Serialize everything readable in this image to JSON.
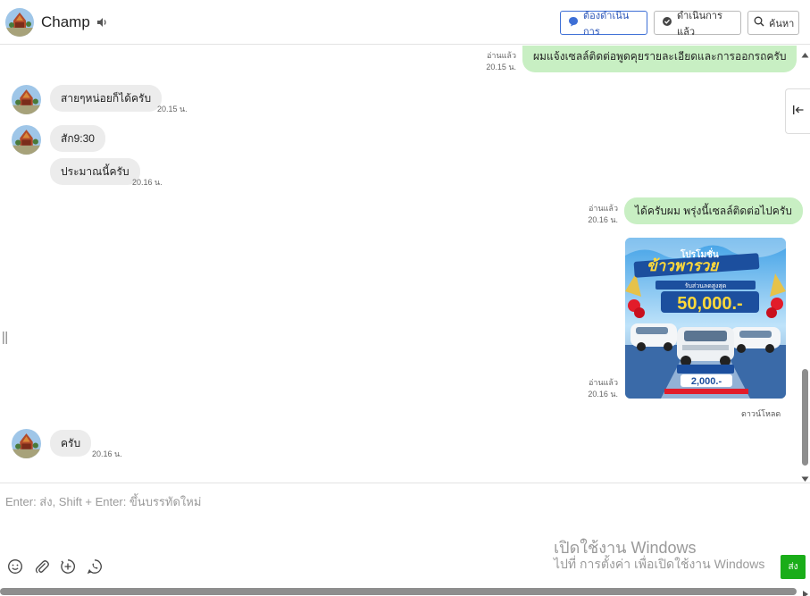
{
  "header": {
    "contact_name": "Champ",
    "btn_todo": "ต้องดำเนินการ",
    "btn_done": "ดำเนินการแล้ว",
    "btn_search": "ค้นหา"
  },
  "messages": {
    "m0": {
      "text": "ผมแจ้งเซลล์ติดต่อพูดคุยรายละเอียดและการออกรถครับ",
      "read": "อ่านแล้ว",
      "time": "20.15 น."
    },
    "m1": {
      "text": "สายๆหน่อยก็ได้ครับ",
      "time": "20.15 น."
    },
    "m2": {
      "text": "สัก9:30"
    },
    "m3": {
      "text": "ประมาณนี้ครับ",
      "time": "20.16 น."
    },
    "m4": {
      "text": "ได้ครับผม พรุ่งนี้เซลล์ติดต่อไปครับ",
      "read": "อ่านแล้ว",
      "time": "20.16 น."
    },
    "m5": {
      "read": "อ่านแล้ว",
      "time": "20.16 น.",
      "download": "ดาวน์โหลด",
      "image": {
        "headline_top": "โปรโมชั่น",
        "headline": "ข้าวพารวย",
        "subline": "รับส่วนลดสูงสุด",
        "amount": "50,000.-",
        "amount_small": "2,000.-"
      }
    },
    "m6": {
      "text": "ครับ",
      "time": "20.16 น."
    }
  },
  "composer": {
    "placeholder": "Enter: ส่ง, Shift + Enter: ขึ้นบรรทัดใหม่",
    "send_label": "ส่ง"
  },
  "watermark": {
    "title": "เปิดใช้งาน Windows",
    "subtitle": "ไปที่ การตั้งค่า เพื่อเปิดใช้งาน Windows"
  },
  "colors": {
    "outgoing_bubble": "#c8efc3",
    "incoming_bubble": "#ececec",
    "send_button": "#1aad19",
    "accent": "#3d6fd6"
  },
  "icons": [
    "speaker-icon",
    "chat-bubble-icon",
    "chat-check-icon",
    "search-icon",
    "collapse-panel-icon",
    "emoji-icon",
    "paperclip-icon",
    "plus-circle-icon",
    "whatsapp-icon"
  ]
}
